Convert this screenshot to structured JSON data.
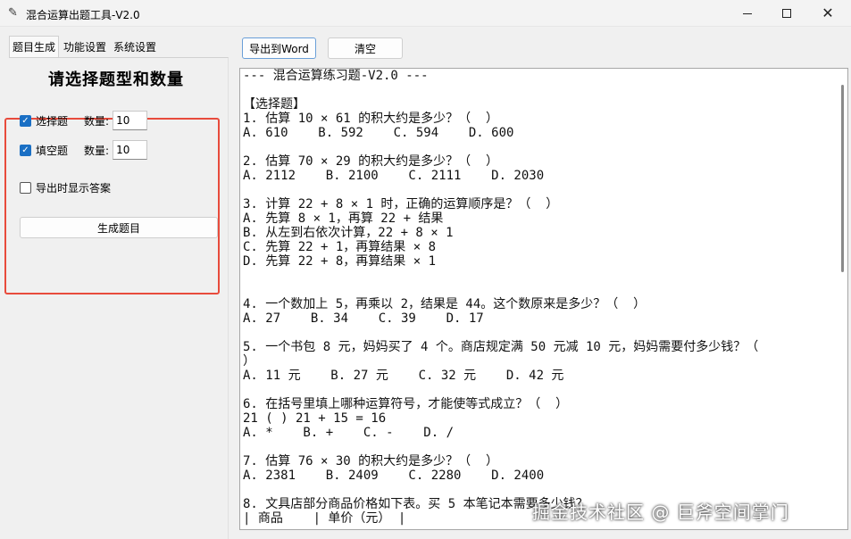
{
  "window": {
    "title": "混合运算出题工具-V2.0",
    "app_icon": "feather-icon",
    "controls": {
      "minimize": "minimize-icon",
      "maximize": "maximize-icon",
      "close": "close-icon",
      "close_glyph": "✕"
    }
  },
  "tabs": [
    {
      "label": "题目生成",
      "active": true
    },
    {
      "label": "功能设置",
      "active": false
    },
    {
      "label": "系统设置",
      "active": false
    }
  ],
  "left_panel": {
    "heading": "请选择题型和数量",
    "choice": {
      "label": "选择题",
      "checked": true,
      "qty_label": "数量:",
      "qty_value": "10"
    },
    "fill": {
      "label": "填空题",
      "checked": true,
      "qty_label": "数量:",
      "qty_value": "10"
    },
    "show_answers": {
      "label": "导出时显示答案",
      "checked": false
    },
    "generate_button": "生成题目"
  },
  "toolbar": {
    "export_label": "导出到Word",
    "clear_label": "清空"
  },
  "output_lines": [
    "--- 混合运算练习题-V2.0 ---",
    "",
    "【选择题】",
    "1. 估算 10 × 61 的积大约是多少？（  ）",
    "A. 610    B. 592    C. 594    D. 600",
    "",
    "2. 估算 70 × 29 的积大约是多少？（  ）",
    "A. 2112    B. 2100    C. 2111    D. 2030",
    "",
    "3. 计算 22 + 8 × 1 时，正确的运算顺序是？（  ）",
    "A. 先算 8 × 1，再算 22 + 结果",
    "B. 从左到右依次计算，22 + 8 × 1",
    "C. 先算 22 + 1，再算结果 × 8",
    "D. 先算 22 + 8，再算结果 × 1",
    "",
    "",
    "4. 一个数加上 5，再乘以 2，结果是 44。这个数原来是多少？（  ）",
    "A. 27    B. 34    C. 39    D. 17",
    "",
    "5. 一个书包 8 元，妈妈买了 4 个。商店规定满 50 元减 10 元，妈妈需要付多少钱？（",
    "）",
    "A. 11 元    B. 27 元    C. 32 元    D. 42 元",
    "",
    "6. 在括号里填上哪种运算符号，才能使等式成立？（  ）",
    "21 ( ) 21 + 15 = 16",
    "A. *    B. +    C. -    D. /",
    "",
    "7. 估算 76 × 30 的积大约是多少？（  ）",
    "A. 2381    B. 2409    C. 2280    D. 2400",
    "",
    "8. 文具店部分商品价格如下表。买 5 本笔记本需要多少钱？",
    "| 商品    | 单价（元） |"
  ],
  "watermark": "掘金技术社区 @ 巨斧空间掌门",
  "colors": {
    "highlight_frame": "#e84b3c",
    "checkbox": "#1a6fc4"
  }
}
